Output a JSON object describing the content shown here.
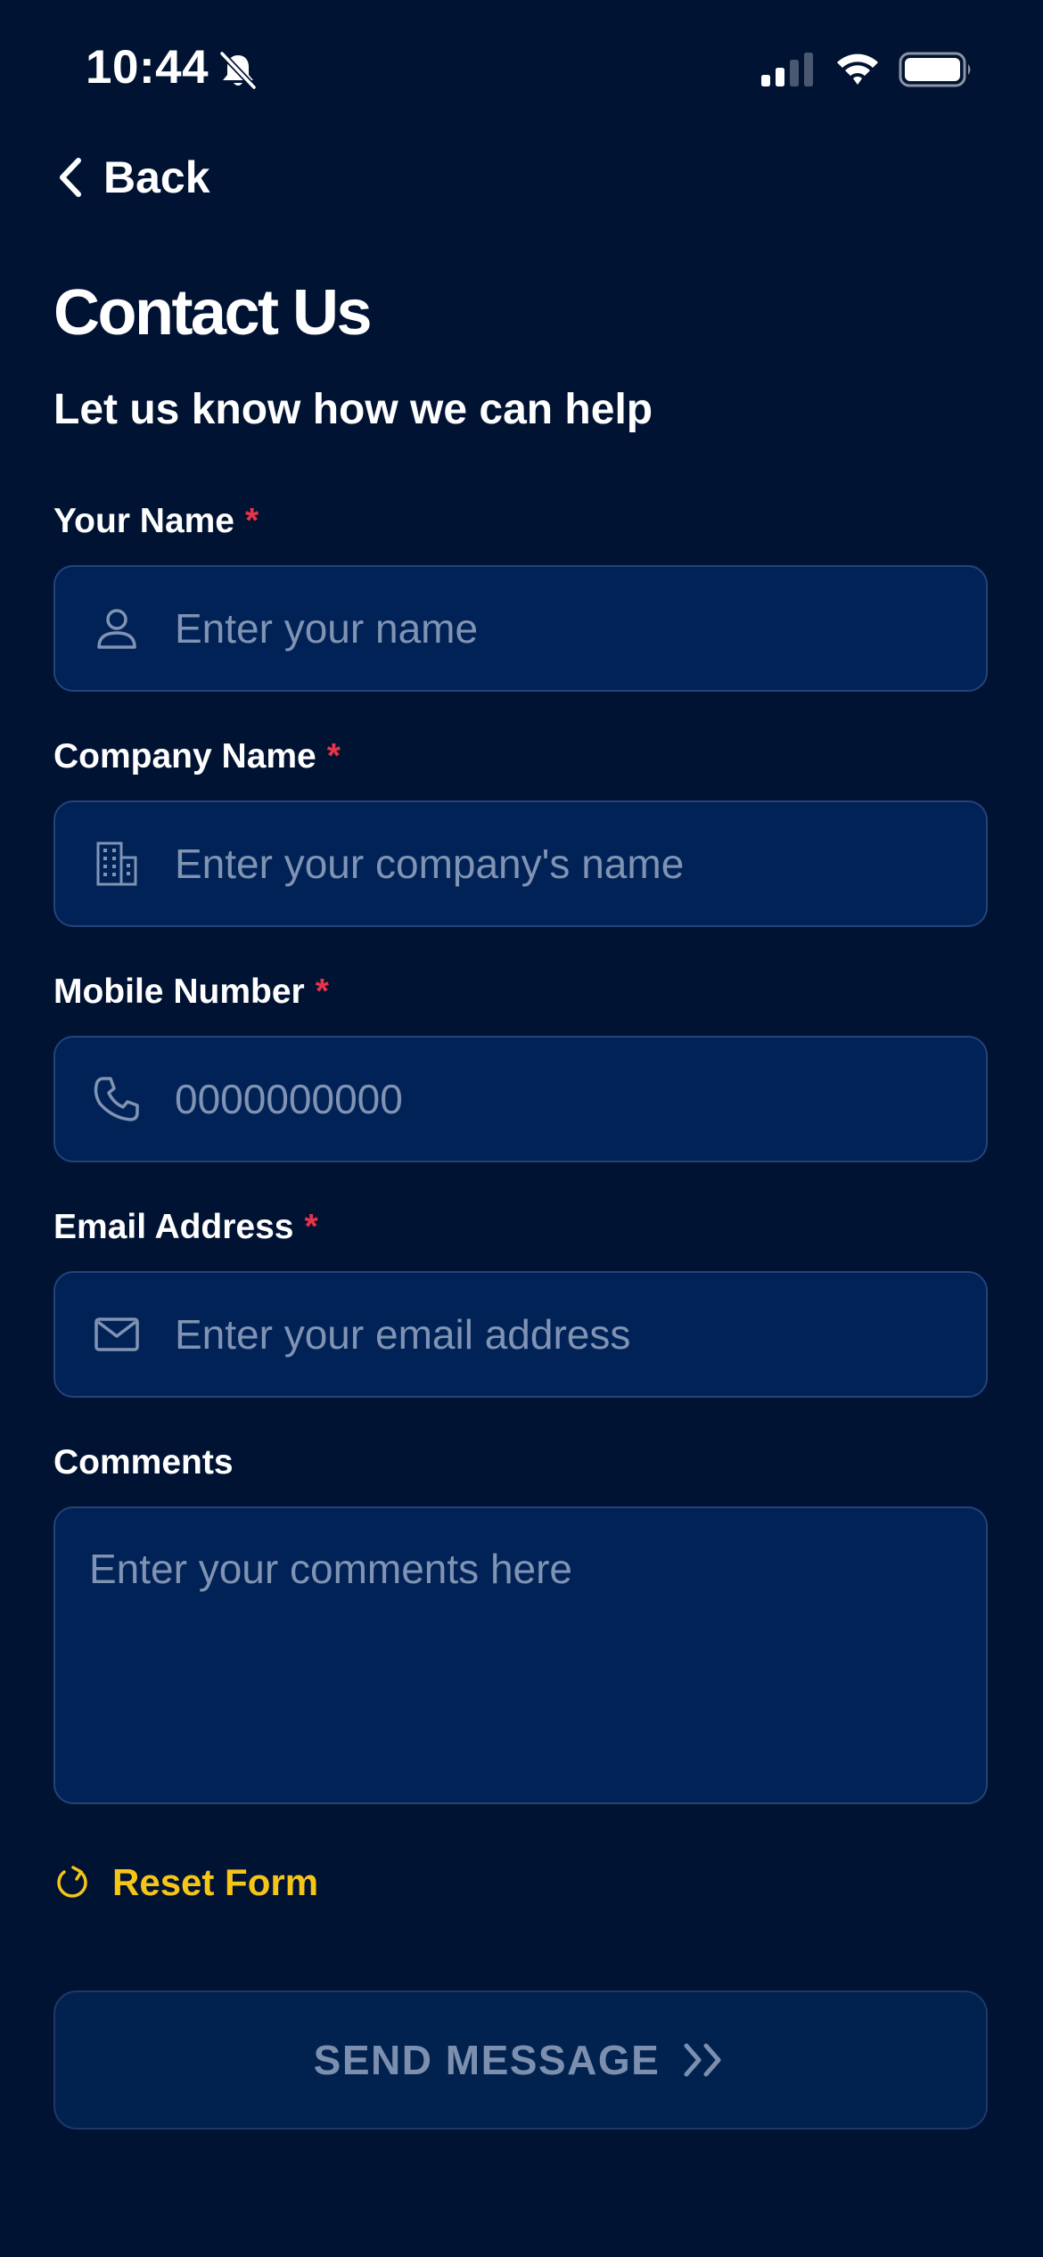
{
  "status_bar": {
    "time": "10:44",
    "icons": [
      "bell-slash-icon",
      "cellular-signal-icon",
      "wifi-icon",
      "battery-icon"
    ]
  },
  "nav": {
    "back_label": "Back",
    "back_icon": "chevron-left-icon"
  },
  "header": {
    "title": "Contact Us",
    "subtitle": "Let us know how we can help"
  },
  "form": {
    "fields": [
      {
        "label": "Your Name",
        "required_mark": "*",
        "placeholder": "Enter your name",
        "value": "",
        "icon": "user-icon"
      },
      {
        "label": "Company Name",
        "required_mark": "*",
        "placeholder": "Enter your company's name",
        "value": "",
        "icon": "building-icon"
      },
      {
        "label": "Mobile Number",
        "required_mark": "*",
        "placeholder": "0000000000",
        "value": "",
        "icon": "phone-icon"
      },
      {
        "label": "Email Address",
        "required_mark": "*",
        "placeholder": "Enter your email address",
        "value": "",
        "icon": "envelope-icon"
      }
    ],
    "comments": {
      "label": "Comments",
      "placeholder": "Enter your comments here",
      "value": ""
    },
    "reset_label": "Reset Form",
    "reset_icon": "refresh-icon",
    "submit_label": "SEND MESSAGE",
    "submit_icon": "double-chevron-right-icon"
  },
  "colors": {
    "background": "#011333",
    "field_background": "#012256",
    "field_border": "#25427a",
    "required": "#e8334a",
    "accent_yellow": "#f5c518",
    "placeholder": "#8093b3",
    "disabled_text": "#7d8fae"
  }
}
